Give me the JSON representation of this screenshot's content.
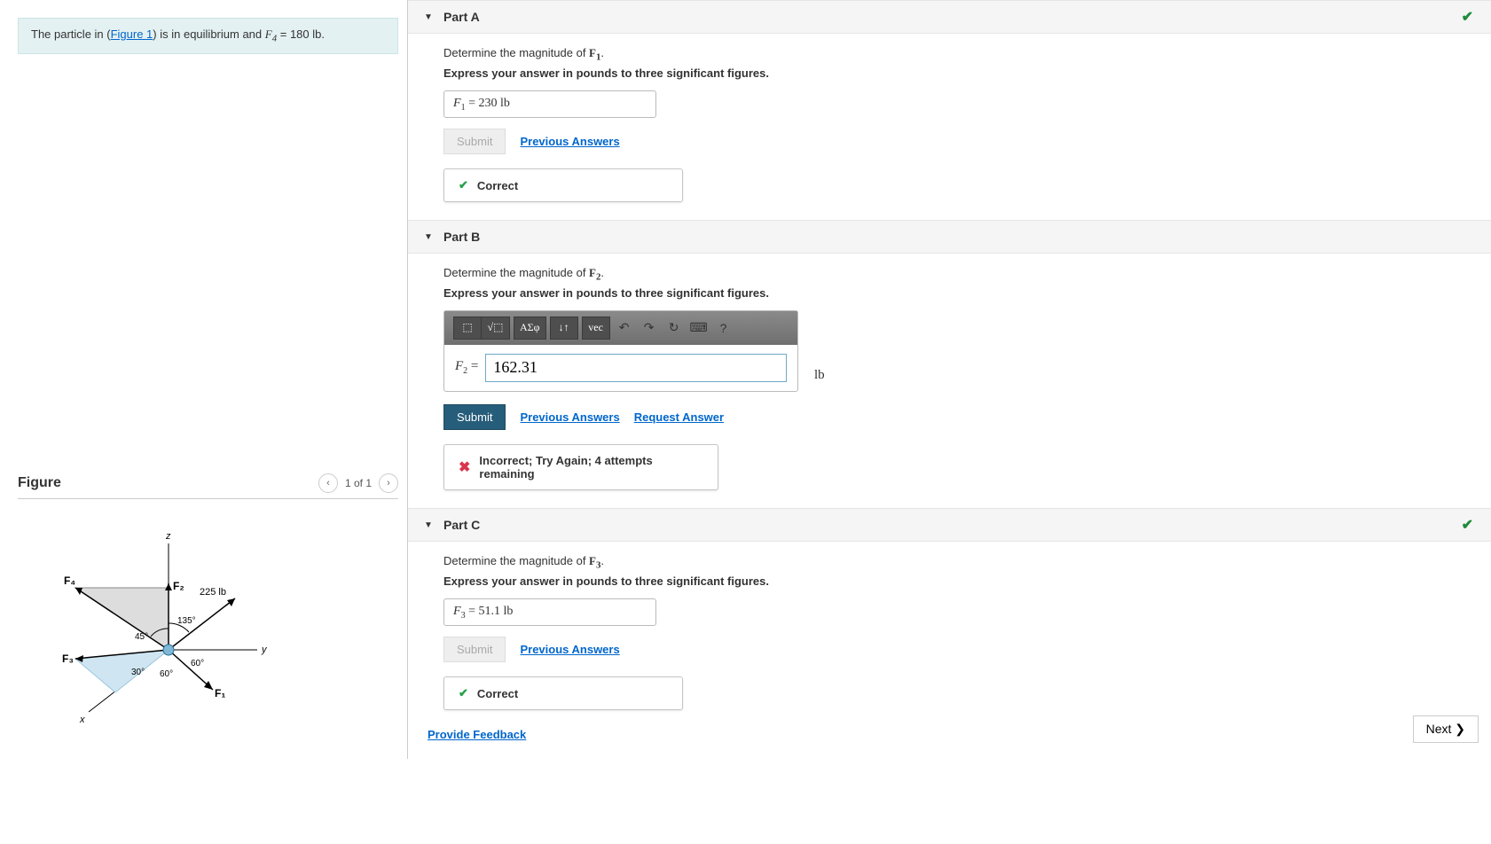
{
  "problem": {
    "text_pre": "The particle in (",
    "figure_link": "Figure 1",
    "text_mid": ") is in equilibrium and ",
    "F4_label": "F",
    "F4_sub": "4",
    "F4_eq": " = 180 lb."
  },
  "figure": {
    "title": "Figure",
    "pager": "1 of 1",
    "labels": {
      "z": "z",
      "y": "y",
      "x": "x",
      "F1": "F₁",
      "F2": "F₂",
      "F3": "F₃",
      "F4": "F₄",
      "val225": "225 lb",
      "a135": "135°",
      "a45": "45°",
      "a30": "30°",
      "a60a": "60°",
      "a60b": "60°"
    }
  },
  "partA": {
    "title": "Part A",
    "instr": "Determine the magnitude of ",
    "var": "F",
    "sub": "1",
    "period": ".",
    "instr2": "Express your answer in pounds to three significant figures.",
    "ans_var": "F",
    "ans_sub": "1",
    "ans_eq": " = ",
    "ans_val": "230",
    "ans_unit": " lb",
    "submit": "Submit",
    "prev": "Previous Answers",
    "fb": "Correct"
  },
  "partB": {
    "title": "Part B",
    "instr": "Determine the magnitude of ",
    "var": "F",
    "sub": "2",
    "period": ".",
    "instr2": "Express your answer in pounds to three significant figures.",
    "tb": {
      "tmpl": "⬚",
      "sqrt": "√",
      "greek": "ΑΣφ",
      "arrows": "↓↑",
      "vec": "vec",
      "undo": "↶",
      "redo": "↷",
      "reset": "↻",
      "kbd": "⌨",
      "help": "?"
    },
    "ans_var": "F",
    "ans_sub": "2",
    "ans_eq": " = ",
    "input_val": "162.31",
    "unit": "lb",
    "submit": "Submit",
    "prev": "Previous Answers",
    "req": "Request Answer",
    "fb": "Incorrect; Try Again; 4 attempts remaining"
  },
  "partC": {
    "title": "Part C",
    "instr": "Determine the magnitude of ",
    "var": "F",
    "sub": "3",
    "period": ".",
    "instr2": "Express your answer in pounds to three significant figures.",
    "ans_var": "F",
    "ans_sub": "3",
    "ans_eq": " = ",
    "ans_val": "51.1",
    "ans_unit": " lb",
    "submit": "Submit",
    "prev": "Previous Answers",
    "fb": "Correct"
  },
  "footer": {
    "feedback": "Provide Feedback",
    "next": "Next ❯"
  }
}
